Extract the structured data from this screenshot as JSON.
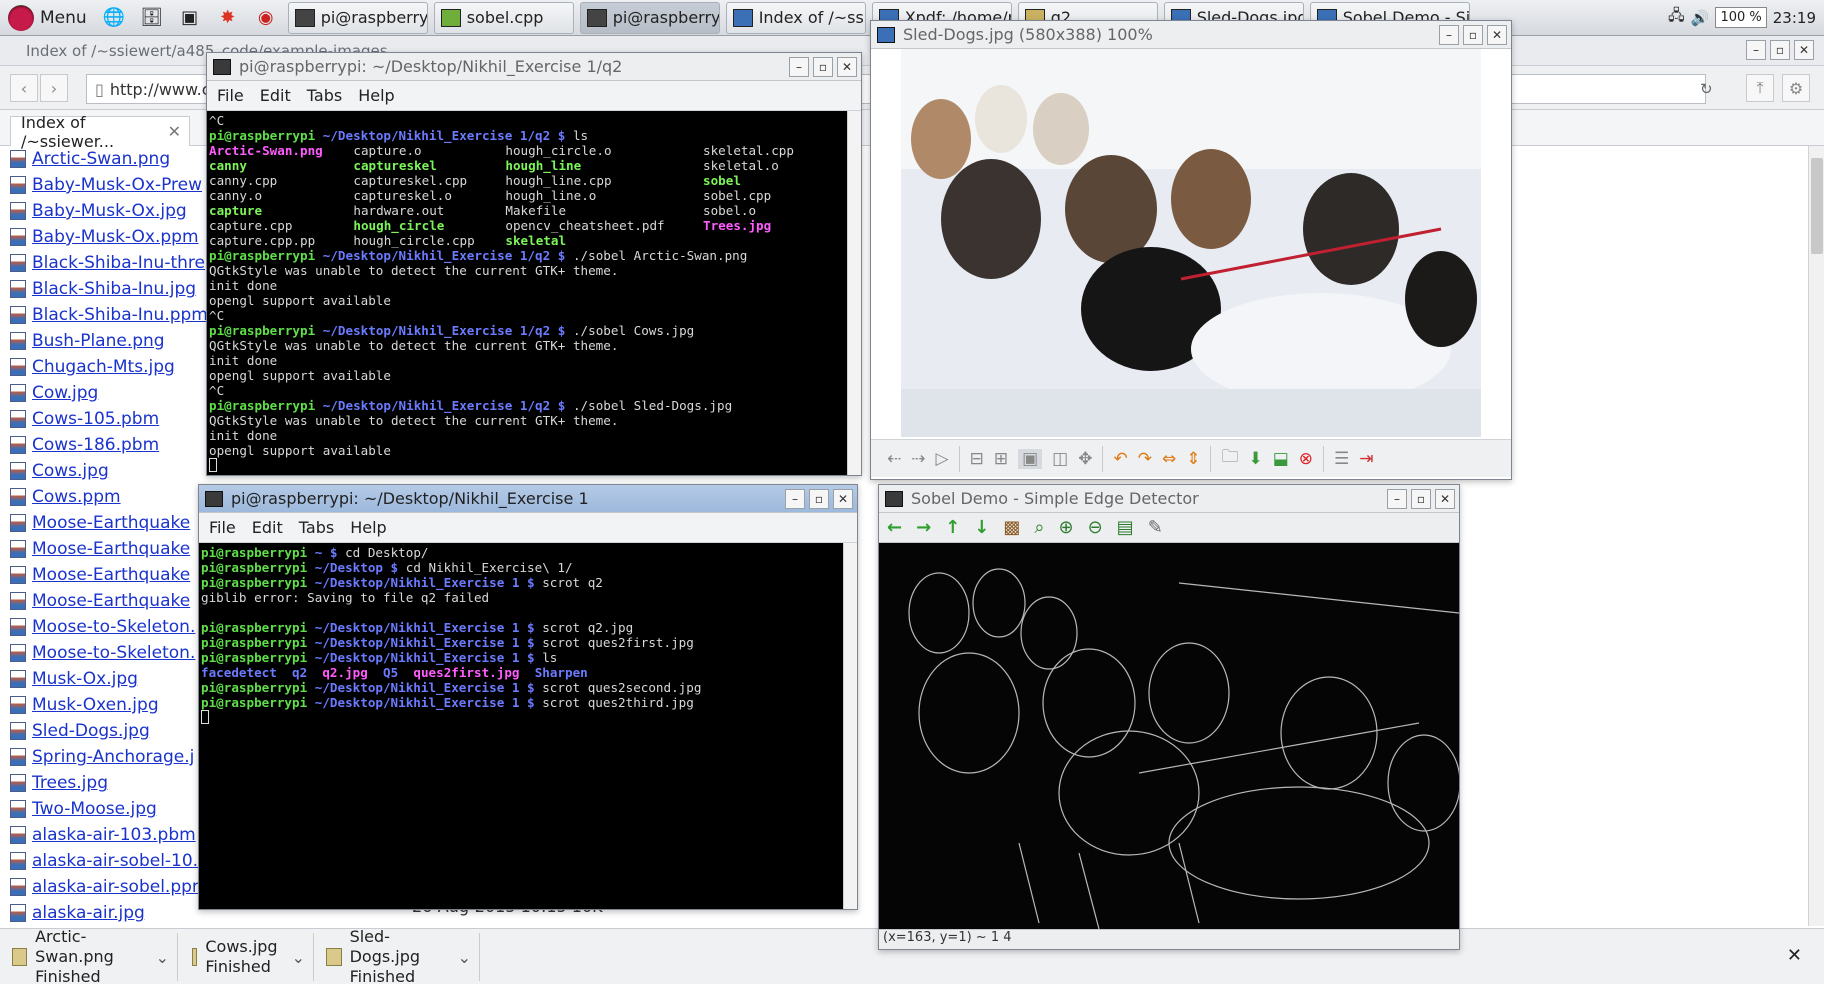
{
  "taskbar": {
    "menu_label": "Menu",
    "tasks": [
      {
        "label": "pi@raspberrypi: ...",
        "icon": "terminal-icon"
      },
      {
        "label": "sobel.cpp",
        "icon": "text-editor-icon"
      },
      {
        "label": "pi@raspberrypi: ...",
        "icon": "terminal-icon"
      },
      {
        "label": "Index of /~ssiew...",
        "icon": "browser-icon"
      },
      {
        "label": "Xpdf: /home/pi/...",
        "icon": "pdf-icon"
      },
      {
        "label": "q2",
        "icon": "folder-icon"
      },
      {
        "label": "Sled-Dogs.jpg (5...",
        "icon": "image-icon"
      },
      {
        "label": "Sobel Demo - Si...",
        "icon": "image-icon"
      }
    ],
    "cpu": "100 %",
    "clock": "23:19"
  },
  "browser": {
    "window_title": "Index of /~ssiewert/a485_code/example-images",
    "url": "http://www.cs",
    "tab_label": "Index of /~ssiewer...",
    "files": [
      "Arctic-Swan.png",
      "Baby-Musk-Ox-Prew",
      "Baby-Musk-Ox.jpg",
      "Baby-Musk-Ox.ppm",
      "Black-Shiba-Inu-thre",
      "Black-Shiba-Inu.jpg",
      "Black-Shiba-Inu.ppm",
      "Bush-Plane.png",
      "Chugach-Mts.jpg",
      "Cow.jpg",
      "Cows-105.pbm",
      "Cows-186.pbm",
      "Cows.jpg",
      "Cows.ppm",
      "Moose-Earthquake",
      "Moose-Earthquake",
      "Moose-Earthquake",
      "Moose-Earthquake",
      "Moose-to-Skeleton.",
      "Moose-to-Skeleton.",
      "Musk-Ox.jpg",
      "Musk-Oxen.jpg",
      "Sled-Dogs.jpg",
      "Spring-Anchorage.j",
      "Trees.jpg",
      "Two-Moose.jpg",
      "alaska-air-103.pbm",
      "alaska-air-sobel-10.",
      "alaska-air-sobel.ppr",
      "alaska-air.jpg"
    ],
    "partial_row_text": "26-Aug-2015 10:15  10K",
    "downloads": [
      {
        "name": "Arctic-Swan.png",
        "status": "Finished"
      },
      {
        "name": "Cows.jpg",
        "status": "Finished"
      },
      {
        "name": "Sled-Dogs.jpg",
        "status": "Finished"
      }
    ],
    "downloads_close": "✕"
  },
  "term1": {
    "title": "pi@raspberrypi: ~/Desktop/Nikhil_Exercise 1/q2",
    "menu": [
      "File",
      "Edit",
      "Tabs",
      "Help"
    ],
    "prompt_user": "pi@raspberrypi",
    "prompt_path": " ~/Desktop/Nikhil_Exercise 1/q2 $ ",
    "cmd_ls": "ls",
    "cmd_run1": "./sobel Arctic-Swan.png",
    "cmd_run2": "./sobel Cows.jpg",
    "cmd_run3": "./sobel Sled-Dogs.jpg",
    "ctrlc": "^C",
    "ls_files": [
      [
        "Arctic-Swan.png",
        "capture.o",
        "hough_circle.o",
        "skeletal.cpp"
      ],
      [
        "canny",
        "captureskel",
        "hough_line",
        "skeletal.o"
      ],
      [
        "canny.cpp",
        "captureskel.cpp",
        "hough_line.cpp",
        "sobel"
      ],
      [
        "canny.o",
        "captureskel.o",
        "hough_line.o",
        "sobel.cpp"
      ],
      [
        "capture",
        "hardware.out",
        "Makefile",
        "sobel.o"
      ],
      [
        "capture.cpp",
        "hough_circle",
        "opencv_cheatsheet.pdf",
        "Trees.jpg"
      ],
      [
        "capture.cpp.pp",
        "hough_circle.cpp",
        "skeletal",
        ""
      ]
    ],
    "msg_gtk": "QGtkStyle was unable to detect the current GTK+ theme.",
    "msg_init": "init done",
    "msg_opengl": "opengl support available"
  },
  "term2": {
    "title": "pi@raspberrypi: ~/Desktop/Nikhil_Exercise 1",
    "menu": [
      "File",
      "Edit",
      "Tabs",
      "Help"
    ],
    "prompt_user": "pi@raspberrypi",
    "p_home": " ~ $ ",
    "p_desktop": " ~/Desktop $ ",
    "p_ex": " ~/Desktop/Nikhil_Exercise 1 $ ",
    "c1": "cd Desktop/",
    "c2": "cd Nikhil_Exercise\\ 1/",
    "c3": "scrot q2",
    "err": "giblib error: Saving to file q2 failed",
    "c4": "scrot q2.jpg",
    "c5": "scrot ques2first.jpg",
    "c6": "ls",
    "ls_items": [
      "facedetect",
      "q2",
      "q2.jpg",
      "Q5",
      "ques2first.jpg",
      "Sharpen"
    ],
    "c7": "scrot ques2second.jpg",
    "c8": "scrot ques2third.jpg"
  },
  "viewer": {
    "title": "Sled-Dogs.jpg (580x388) 100%"
  },
  "sobel": {
    "title": "Sobel Demo - Simple Edge Detector",
    "status": "(x=163, y=1) ~ 1 4"
  },
  "colors": {
    "prompt_user": "#5fe04a",
    "prompt_path": "#6b7bff",
    "image_files": "#ff5cff",
    "link": "#1a33cc"
  }
}
